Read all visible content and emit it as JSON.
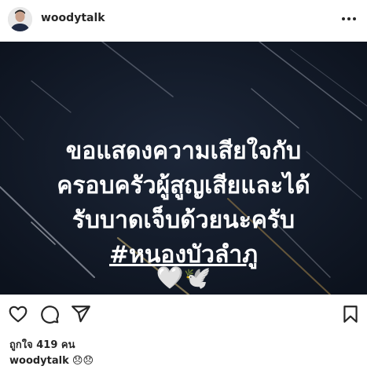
{
  "post": {
    "username": "woodytalk",
    "image_lines": [
      "ขอแสดงความเสียใจกับ",
      "ครอบครัวผู้สูญเสียและได้",
      "รับบาดเจ็บด้วยนะครับ"
    ],
    "hashtag": "#หนองบัวลำภู",
    "image_emoji": "🤍🕊️",
    "likes_text": "ถูกใจ 419 คน",
    "caption_username": "woodytalk",
    "caption_text": "😞😞"
  },
  "icons": {
    "more": "more-options-icon",
    "like": "heart-icon",
    "comment": "comment-icon",
    "share": "send-icon",
    "save": "bookmark-icon"
  },
  "colors": {
    "image_background": "#121a28",
    "text": "#262626"
  }
}
